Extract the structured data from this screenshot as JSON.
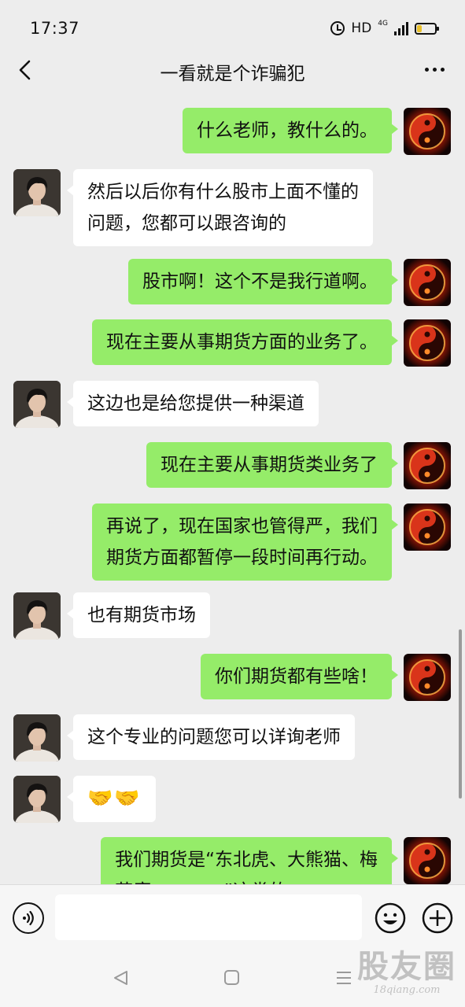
{
  "status_bar": {
    "time": "17:37",
    "hd_label": "HD",
    "network_label": "4G",
    "battery_level": 0.25
  },
  "header": {
    "title": "一看就是个诈骗犯"
  },
  "messages": [
    {
      "from": "self",
      "text": "什么老师，教什么的。"
    },
    {
      "from": "other",
      "lines": [
        "然后以后你有什么股市上面不懂的",
        "问题，您都可以跟咨询的"
      ]
    },
    {
      "from": "self",
      "text": "股市啊！这个不是我行道啊。"
    },
    {
      "from": "self",
      "text": "现在主要从事期货方面的业务了。"
    },
    {
      "from": "other",
      "text": "这边也是给您提供一种渠道"
    },
    {
      "from": "self",
      "text": "现在主要从事期货类业务了"
    },
    {
      "from": "self",
      "lines": [
        "再说了，现在国家也管得严，我们",
        "期货方面都暂停一段时间再行动。"
      ]
    },
    {
      "from": "other",
      "text": "也有期货市场"
    },
    {
      "from": "self",
      "text": "你们期货都有些啥！"
    },
    {
      "from": "other",
      "text": "这个专业的问题您可以详询老师"
    },
    {
      "from": "other",
      "text": "🤝🤝"
    },
    {
      "from": "self",
      "lines": [
        "我们期货是“东北虎、大熊猫、梅",
        "花鹿…………”这类的"
      ]
    }
  ],
  "input": {
    "value": ""
  },
  "icons": {
    "back": "back-arrow-icon",
    "more": "more-dots-icon",
    "voice": "voice-icon",
    "emoji": "emoji-icon",
    "plus": "plus-icon",
    "alarm": "alarm-icon",
    "signal": "signal-icon",
    "battery": "battery-icon"
  },
  "colors": {
    "sent_bubble": "#95ec69",
    "received_bubble": "#ffffff",
    "background": "#ededed",
    "battery": "#e9c02a"
  },
  "watermark": {
    "main": "股友圈",
    "url": "18qiang.com"
  }
}
